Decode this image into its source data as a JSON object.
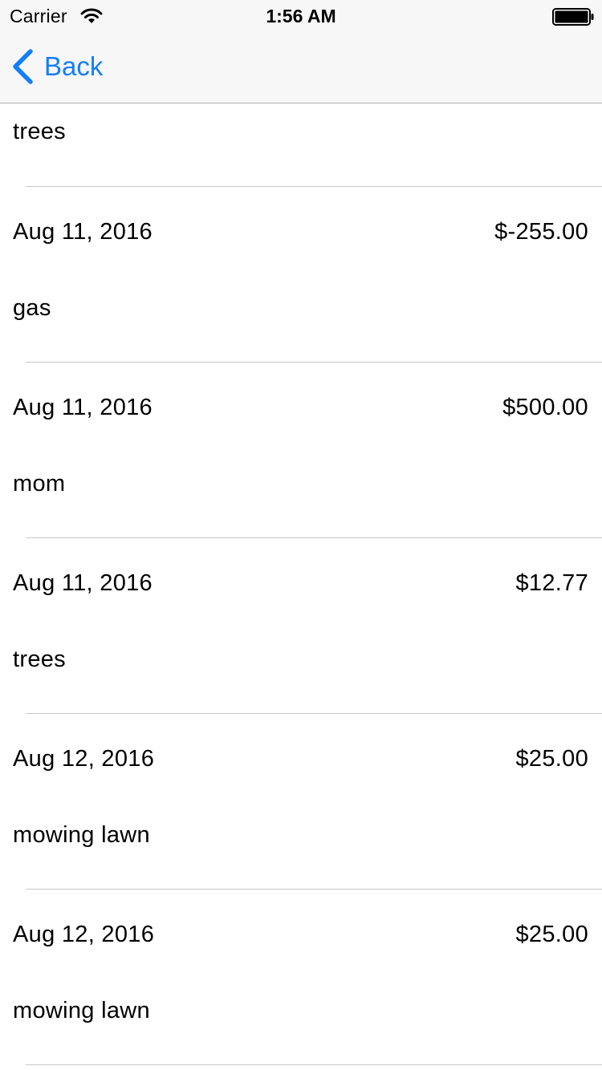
{
  "status_bar": {
    "carrier": "Carrier",
    "time": "1:56 AM",
    "icons": [
      "wifi-icon",
      "battery-icon"
    ]
  },
  "nav": {
    "back_label": "Back",
    "back_icon": "chevron-left-icon",
    "accent_color": "#147efb"
  },
  "transactions": [
    {
      "memo": "trees"
    },
    {
      "date": "Aug 11, 2016",
      "amount": "$-255.00",
      "memo": "gas"
    },
    {
      "date": "Aug 11, 2016",
      "amount": "$500.00",
      "memo": "mom"
    },
    {
      "date": "Aug 11, 2016",
      "amount": "$12.77",
      "memo": "trees"
    },
    {
      "date": "Aug 12, 2016",
      "amount": "$25.00",
      "memo": "mowing lawn"
    },
    {
      "date": "Aug 12, 2016",
      "amount": "$25.00",
      "memo": "mowing lawn"
    }
  ]
}
